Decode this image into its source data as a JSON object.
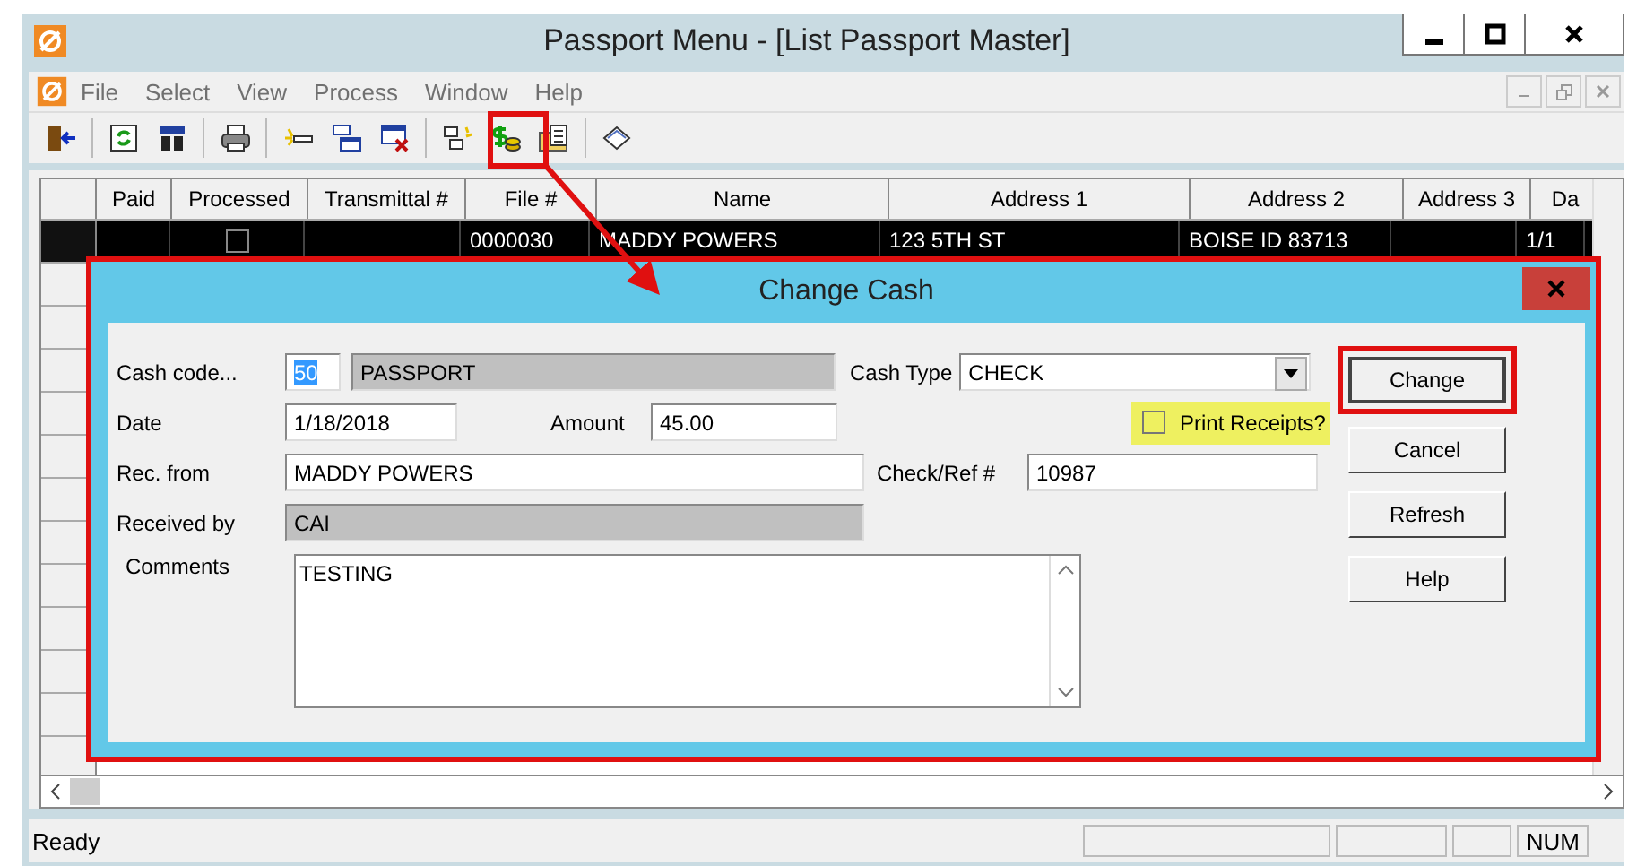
{
  "window": {
    "title": "Passport Menu - [List Passport Master]"
  },
  "menu": [
    "File",
    "Select",
    "View",
    "Process",
    "Window",
    "Help"
  ],
  "table": {
    "columns": [
      "Paid",
      "Processed",
      "Transmittal #",
      "File #",
      "Name",
      "Address 1",
      "Address 2",
      "Address 3",
      "Da"
    ],
    "rows": [
      {
        "selected": true,
        "processed": false,
        "file": "0000030",
        "name": "MADDY POWERS",
        "address_1": "123 5TH ST",
        "address_2": "BOISE ID 83713",
        "column_9": "1/1"
      }
    ]
  },
  "dialog": {
    "title": "Change Cash",
    "cash_code": {
      "label": "Cash code...",
      "code": "50",
      "code_selected": true,
      "description": "PASSPORT"
    },
    "cash_type": {
      "label": "Cash Type",
      "value": "CHECK"
    },
    "date": {
      "label": "Date",
      "value": "1/18/2018"
    },
    "amount": {
      "label": "Amount",
      "value": "45.00"
    },
    "print_receipts": {
      "label": "Print Receipts?",
      "checked": false
    },
    "rec_from": {
      "label": "Rec. from",
      "value": "MADDY POWERS"
    },
    "check_ref": {
      "label": "Check/Ref #",
      "value": "10987"
    },
    "received_by": {
      "label": "Received by",
      "value": "CAI"
    },
    "comments": {
      "label": "Comments",
      "value": "TESTING"
    },
    "buttons": [
      {
        "label": "Change",
        "default": true
      },
      {
        "label": "Cancel",
        "default": false
      },
      {
        "label": "Refresh",
        "default": false
      },
      {
        "label": "Help",
        "default": false
      }
    ]
  },
  "status_bar": {
    "text": "Ready",
    "indicators": [
      "NUM"
    ]
  }
}
